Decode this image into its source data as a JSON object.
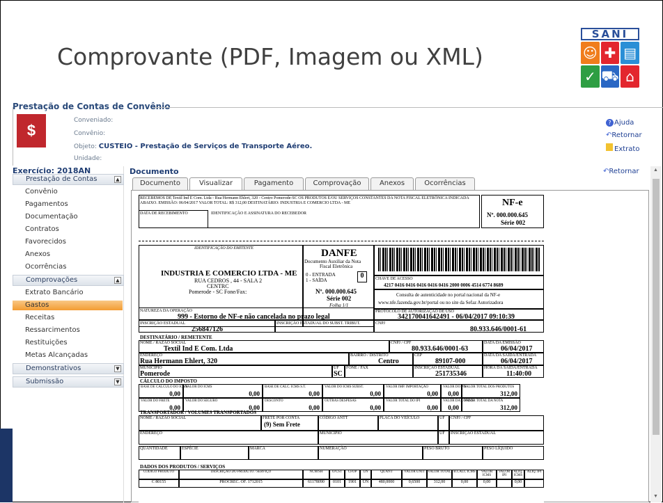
{
  "slide": {
    "title": "Comprovante (PDF, Imagem ou XML)",
    "logo_text": "SANI"
  },
  "app": {
    "title": "Prestação de Contas de Convênio",
    "conveniado_label": "Conveniado:",
    "convenio_label": "Convênio:",
    "objeto_label": "Objeto:",
    "objeto_value": "CUSTEIO - Prestação de Serviços de Transporte Aéreo.",
    "unidade_label": "Unidade:",
    "links": {
      "ajuda": "Ajuda",
      "retornar": "Retornar",
      "extrato": "Extrato"
    }
  },
  "sidebar": {
    "exercicio": "Exercício: 2018AN",
    "sections": {
      "prestacao": "Prestação de Contas",
      "comprovacoes": "Comprovações",
      "demonstrativos": "Demonstrativos",
      "submissao": "Submissão"
    },
    "items1": [
      "Convênio",
      "Pagamentos",
      "Documentação",
      "Contratos",
      "Favorecidos",
      "Anexos",
      "Ocorrências"
    ],
    "items2": [
      "Extrato Bancário",
      "Gastos",
      "Receitas",
      "Ressarcimentos",
      "Restituições",
      "Metas Alcançadas"
    ],
    "active": "Gastos"
  },
  "main": {
    "title": "Documento",
    "retornar": "Retornar",
    "tabs": [
      "Documento",
      "Visualizar",
      "Pagamento",
      "Comprovação",
      "Anexos",
      "Ocorrências"
    ],
    "active_tab": "Visualizar"
  },
  "danfe": {
    "canhoto": "RECEBEMOS DE Textil Ind E Com. Ltda - Rua Hermann Ehlert, 320 - Centro Pomerode-SC OS PRODUTOS E/OU SERVIÇOS CONSTANTES DA NOTA FISCAL ELETRÔNICA INDICADA ABAIXO. EMISSÃO: 06/04/2017 VALOR TOTAL: R$ 312,00 DESTINATÁRIO: INDUSTRIA E COMERCIO LTDA - ME",
    "data_recebimento": "DATA DE RECEBIMENTO",
    "identificacao_assinatura": "IDENTIFICAÇÃO E ASSINATURA DO RECEBEDOR",
    "nfe": "NF-e",
    "nfe_num": "Nº. 000.000.645",
    "nfe_serie": "Série 002",
    "ident_emitente": "IDENTIFICAÇÃO DO EMITENTE",
    "emitente_nome": "INDUSTRIA E COMERCIO LTDA - ME",
    "emitente_end1": "RUA CEDROS , 44 - SALA 2",
    "emitente_end2": "CENTRC",
    "emitente_end3": "Pomerode - SC Fone/Fax:",
    "danfe_title": "DANFE",
    "danfe_sub1": "Documento Auxiliar da Nota",
    "danfe_sub2": "Fiscal Eletrônica",
    "entrada": "0 - ENTRADA",
    "saida": "1 - SAÍDA",
    "tipo": "0",
    "num": "Nº. 000.000.645",
    "serie": "Série 002",
    "folha": "Folha 1/1",
    "chave_label": "CHAVE DE ACESSO",
    "chave": "4217 0416 0416 0416 0416 0416 2000 0006 4514 6774 8689",
    "consulta1": "Consulta de autenticidade no portal nacional da NF-e",
    "consulta2": "www.nfe.fazenda.gov.br/portal ou no site da Sefaz Autorizadora",
    "natureza_label": "NATUREZA DA OPERAÇÃO",
    "natureza": "999 - Estorno de NF-e não cancelada no prazo legal",
    "protocolo_label": "PROTOCOLO DE AUTORIZAÇÃO DE USO",
    "protocolo": "342170041642491 - 06/04/2017 09:10:39",
    "ie_label": "INSCRIÇÃO ESTADUAL",
    "ie": "256847126",
    "ie_st_label": "INSCRIÇÃO ESTADUAL DO SUBST. TRIBUT.",
    "cnpj_label": "CNPJ",
    "cnpj": "80.933.646/0001-61",
    "dest_header": "DESTINATÁRIO / REMETENTE",
    "nome_label": "NOME / RAZÃO SOCIAL",
    "dest_nome": "Textil Ind E Com. Ltda",
    "cnpjcpf_label": "CNPJ / CPF",
    "dest_cnpj": "80.933.646/0001-63",
    "emissao_label": "DATA DA EMISSÃO",
    "emissao": "06/04/2017",
    "endereco_label": "ENDEREÇO",
    "dest_end": "Rua Hermann Ehlert, 320",
    "bairro_label": "BAIRRO / DISTRITO",
    "bairro": "Centro",
    "cep_label": "CEP",
    "cep": "89107-000",
    "saida_label": "DATA DA SAÍDA/ENTRADA",
    "saida_data": "06/04/2017",
    "municipio_label": "MUNICÍPIO",
    "municipio": "Pomerode",
    "uf_label": "UF",
    "uf": "SC",
    "fone_label": "FONE / FAX",
    "ie2_label": "INSCRIÇÃO ESTADUAL",
    "ie2": "251735346",
    "hora_label": "HORA DA SAÍDA/ENTRADA",
    "hora": "11:40:00",
    "calc_header": "CÁLCULO DO IMPOSTO",
    "impostos_r1": [
      {
        "label": "BASE DE CÁLCULO DO ICMS",
        "value": "0,00"
      },
      {
        "label": "VALOR DO ICMS",
        "value": "0,00"
      },
      {
        "label": "BASE DE CÁLC. ICMS S.T.",
        "value": "0,00"
      },
      {
        "label": "VALOR DO ICMS SUBST.",
        "value": "0,00"
      },
      {
        "label": "VALOR IMP. IMPORTAÇÃO",
        "value": "0,00"
      },
      {
        "label": "VALOR DO PIS",
        "value": "0,00"
      },
      {
        "label": "VALOR TOTAL DOS PRODUTOS",
        "value": "312,00"
      }
    ],
    "impostos_r2": [
      {
        "label": "VALOR DO FRETE",
        "value": "0,00"
      },
      {
        "label": "VALOR DO SEGURO",
        "value": "0,00"
      },
      {
        "label": "DESCONTO",
        "value": "0,00"
      },
      {
        "label": "OUTRAS DESPESAS",
        "value": "0,00"
      },
      {
        "label": "VALOR TOTAL DO IPI",
        "value": "0,00"
      },
      {
        "label": "VALOR DA COFINS",
        "value": "0,00"
      },
      {
        "label": "VALOR TOTAL DA NOTA",
        "value": "312,00"
      }
    ],
    "transp_header": "TRANSPORTADOR / VOLUMES TRANSPORTADOS",
    "frete_label": "FRETE POR CONTA",
    "frete": "(9) Sem Frete",
    "antt_label": "CÓDIGO ANTT",
    "placa_label": "PLACA DO VEÍCULO",
    "inscricao_label": "INSCRIÇÃO ESTADUAL",
    "quantidade_label": "QUANTIDADE",
    "especie_label": "ESPÉCIE",
    "marca_label": "MARCA",
    "numeracao_label": "NUMERAÇÃO",
    "peso_bruto_label": "PESO BRUTO",
    "peso_liquido_label": "PESO LÍQUIDO",
    "produtos_header": "DADOS DOS PRODUTOS / SERVIÇOS",
    "prod_cols": [
      "CÓDIGO PRODUTO",
      "DESCRIÇÃO DO PRODUTO / SERVIÇO",
      "NCM/SH",
      "O/CST",
      "CFOP",
      "UN",
      "QUANT",
      "VALOR UNIT",
      "VALOR TOTAL",
      "B.CÁLC ICMS",
      "VALOR ICMS",
      "VALOR IPI",
      "ALIQ. ICMS",
      "ALIQ. IPI"
    ],
    "prod_row": [
      "C 80155",
      "PROCREC. OF. 1712015",
      "61178090",
      "0101",
      "1901",
      "UN",
      "480,0000",
      "0,6500",
      "312,00",
      "0,00",
      "0,00",
      "",
      "0,00",
      ""
    ]
  },
  "colors": {
    "accent": "#1f3d73",
    "active_item": "#f39c32",
    "logo_border": "#2a4f9a"
  }
}
